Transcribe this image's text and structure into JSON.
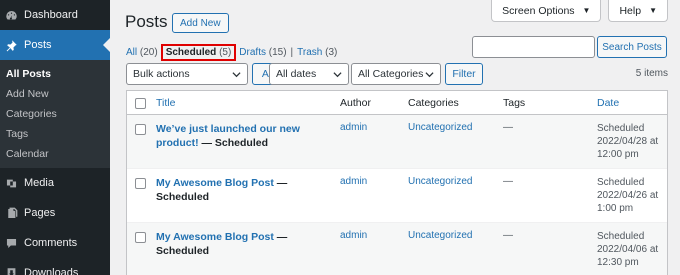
{
  "sidebar": {
    "dashboard": "Dashboard",
    "posts": "Posts",
    "submenu": [
      "All Posts",
      "Add New",
      "Categories",
      "Tags",
      "Calendar"
    ],
    "media": "Media",
    "pages": "Pages",
    "comments": "Comments",
    "downloads": "Downloads"
  },
  "screen_meta": {
    "options": "Screen Options",
    "help": "Help"
  },
  "header": {
    "title": "Posts",
    "add_new": "Add New"
  },
  "filters": {
    "all": "All",
    "all_count": "(20)",
    "scheduled": "Scheduled",
    "scheduled_count": "(5)",
    "drafts": "Drafts",
    "drafts_count": "(15)",
    "trash": "Trash",
    "trash_count": "(3)",
    "sep": "|"
  },
  "search": {
    "button": "Search Posts",
    "value": ""
  },
  "toolbar": {
    "bulk_actions": "Bulk actions",
    "apply": "Apply",
    "dates": "All dates",
    "categories": "All Categories",
    "filter": "Filter",
    "items": "5 items"
  },
  "table": {
    "headers": {
      "title": "Title",
      "author": "Author",
      "categories": "Categories",
      "tags": "Tags",
      "date": "Date"
    },
    "rows": [
      {
        "title": "We’ve just launched our new product!",
        "state": " — Scheduled",
        "author": "admin",
        "category": "Uncategorized",
        "tags": "—",
        "date_status": "Scheduled",
        "date_day": "2022/04/28 at",
        "date_time": "12:00 pm"
      },
      {
        "title": "My Awesome Blog Post",
        "state": " — Scheduled",
        "author": "admin",
        "category": "Uncategorized",
        "tags": "—",
        "date_status": "Scheduled",
        "date_day": "2022/04/26 at",
        "date_time": "1:00 pm"
      },
      {
        "title": "My Awesome Blog Post",
        "state": " — Scheduled",
        "author": "admin",
        "category": "Uncategorized",
        "tags": "—",
        "date_status": "Scheduled",
        "date_day": "2022/04/06 at",
        "date_time": "12:30 pm"
      }
    ]
  },
  "colors": {
    "sidebar": "#1d2327",
    "accent": "#2271b1",
    "highlight": "#e00000"
  }
}
